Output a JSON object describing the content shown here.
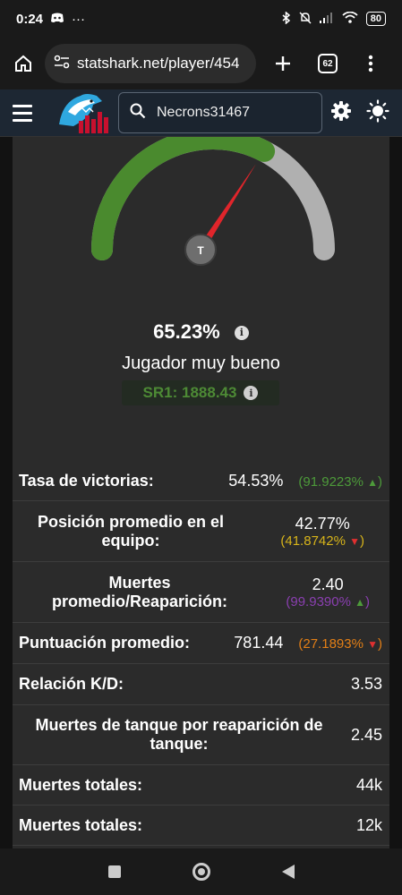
{
  "status_bar": {
    "time": "0:24",
    "battery": "80"
  },
  "browser": {
    "url": "statshark.net/player/454",
    "tab_count": "62"
  },
  "site": {
    "search_value": "Necrons31467"
  },
  "gauge": {
    "score_percent": 65.23,
    "score_text": "65.23%",
    "needle_label": "T",
    "rating": "Jugador muy bueno",
    "sr_text": "SR1: 1888.43",
    "arc_color_filled": "#4a8a2e",
    "arc_color_empty": "#b0b0b0"
  },
  "stats": [
    {
      "label": "Tasa de victorias:",
      "value": "54.53%",
      "pct": "(91.9223%",
      "pct_color": "green",
      "arrow": "▲"
    },
    {
      "label": "Posición promedio en el equipo:",
      "value": "42.77%",
      "pct": "(41.8742%",
      "pct_color": "yellow",
      "arrow": "▼"
    },
    {
      "label": "Muertes promedio/Reaparición:",
      "value": "2.40",
      "pct": "(99.9390%",
      "pct_color": "purple",
      "arrow": "▲"
    },
    {
      "label": "Puntuación promedio:",
      "value": "781.44",
      "pct": "(27.1893%",
      "pct_color": "orange",
      "arrow": "▼"
    },
    {
      "label": "Relación K/D:",
      "value": "3.53"
    },
    {
      "label": "Muertes de tanque por reaparición de tanque:",
      "value": "2.45"
    },
    {
      "label": "Muertes totales:",
      "value": "44k"
    },
    {
      "label": "Muertes totales:",
      "value": "12k"
    }
  ]
}
